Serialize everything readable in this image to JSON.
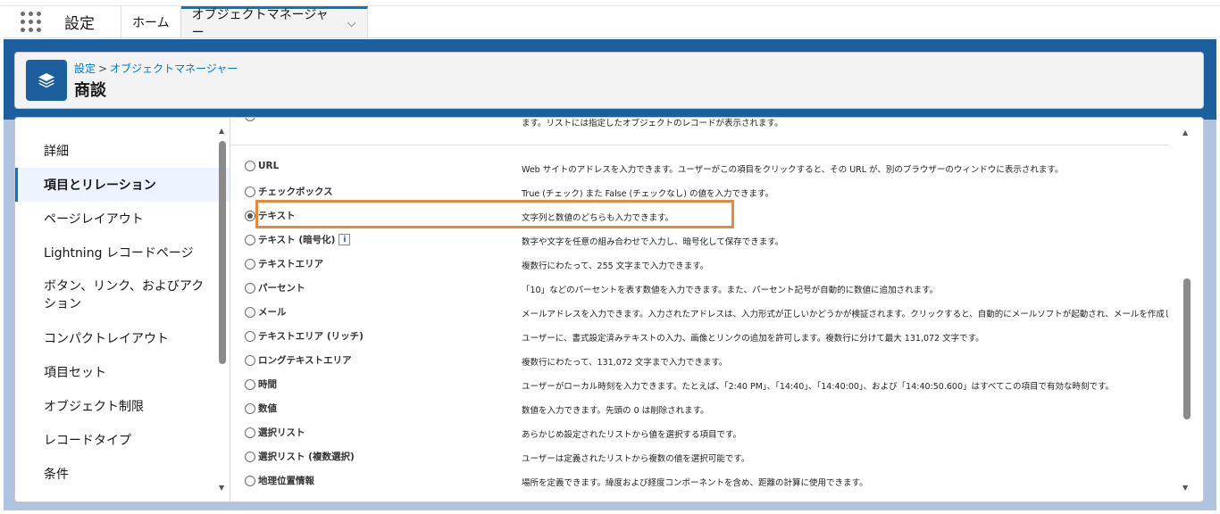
{
  "topbar": {
    "app_name": "設定",
    "tabs": [
      {
        "label": "ホーム"
      },
      {
        "label": "オブジェクトマネージャー"
      }
    ]
  },
  "header": {
    "breadcrumb_root": "設定",
    "breadcrumb_sep": ">",
    "breadcrumb_current": "オブジェクトマネージャー",
    "title": "商談"
  },
  "sidebar": {
    "items": [
      {
        "label": "詳細"
      },
      {
        "label": "項目とリレーション"
      },
      {
        "label": "ページレイアウト"
      },
      {
        "label": "Lightning レコードページ"
      },
      {
        "label": "ボタン、リンク、およびアクション"
      },
      {
        "label": "コンパクトレイアウト"
      },
      {
        "label": "項目セット"
      },
      {
        "label": "オブジェクト制限"
      },
      {
        "label": "レコードタイプ"
      },
      {
        "label": "条件"
      }
    ]
  },
  "field_types": {
    "top_partial_desc": "ます。リストには指定したオブジェクトのレコードが表示されます。",
    "rows": [
      {
        "name": "URL",
        "desc": "Web サイトのアドレスを入力できます。ユーザーがこの項目をクリックすると、その URL が、別のブラウザーのウィンドウに表示されます。"
      },
      {
        "name": "チェックボックス",
        "desc": "True (チェック) また False (チェックなし) の値を入力できます。"
      },
      {
        "name": "テキスト",
        "desc": "文字列と数値のどちらも入力できます。"
      },
      {
        "name": "テキスト (暗号化)",
        "desc": "数字や文字を任意の組み合わせで入力し、暗号化して保存できます。"
      },
      {
        "name": "テキストエリア",
        "desc": "複数行にわたって、255 文字まで入力できます。"
      },
      {
        "name": "パーセント",
        "desc": "「10」などのパーセントを表す数値を入力できます。また、パーセント記号が自動的に数値に追加されます。"
      },
      {
        "name": "メール",
        "desc": "メールアドレスを入力できます。入力されたアドレスは、入力形式が正しいかどうかが検証されます。クリックすると、自動的にメールソフトが起動され、メールを作成して送信できます。"
      },
      {
        "name": "テキストエリア (リッチ)",
        "desc": "ユーザーに、書式設定済みテキストの入力、画像とリンクの追加を許可します。複数行に分けて最大 131,072 文字です。"
      },
      {
        "name": "ロングテキストエリア",
        "desc": "複数行にわたって、131,072 文字まで入力できます。"
      },
      {
        "name": "時間",
        "desc": "ユーザーがローカル時刻を入力できます。たとえば、「2:40 PM」、「14:40」、「14:40:00」、および「14:40:50.600」はすべてこの項目で有効な時刻です。"
      },
      {
        "name": "数値",
        "desc": "数値を入力できます。先頭の 0 は削除されます。"
      },
      {
        "name": "選択リスト",
        "desc": "あらかじめ設定されたリストから値を選択する項目です。"
      },
      {
        "name": "選択リスト (複数選択)",
        "desc": "ユーザーは定義されたリストから複数の値を選択可能です。"
      },
      {
        "name": "地理位置情報",
        "desc": "場所を定義できます。緯度および経度コンポーネントを含め、距離の計算に使用できます。"
      }
    ],
    "selected": "テキスト"
  },
  "colors": {
    "brand": "#1b5f9e",
    "highlight": "#e58a3c",
    "link": "#0176d3"
  }
}
